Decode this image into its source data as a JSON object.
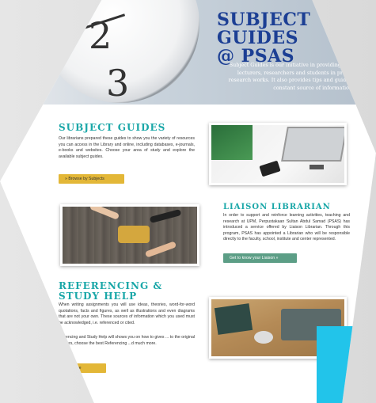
{
  "hero": {
    "title_line1": "SUBJECT",
    "title_line2": "GUIDES",
    "title_line3": "@ PSAS",
    "description": "Subject Guides is our initiative in providing be... lecturers, researchers and students in prep... research works. It also provides tips and guide... constant source of information.",
    "clock_numbers": [
      "2",
      "3"
    ]
  },
  "subject_guides": {
    "title": "SUBJECT GUIDES",
    "text": "Our librarians prepared these guides to show you the variety of resources you can access in the Library and online, including databases, e-journals, e-books and websites. Choose your area of study and explore the available subject guides.",
    "button": "» Browse by Subjects"
  },
  "liaison": {
    "title": "LIAISON LIBRARIAN",
    "text": "In order to support and reinforce learning activities, teaching and research at UPM, Perpustakaan Sultan Abdul Samad (PSAS) has introduced a service offered by Liaison Librarian. Through this program, PSAS has appointed a Librarian who will be responsible directly to the faculty, school, institute and center represented.",
    "button": "Get to know your Liaison »"
  },
  "referencing": {
    "title_line1": "REFERENCING &",
    "title_line2": "STUDY HELP",
    "text1": "When writing assignments you will use ideas, theories, word-for-word quotations, facts and figures, as well as illustrations and even diagrams that are not your own. These sources of information which you used must be acknowledged, i.e. referenced or cited.",
    "text2": "...erencing and Study Help will shows you on how to gives ... to the original authors, choose the best Referencing ...d much more.",
    "button": "...n More"
  },
  "colors": {
    "accent_teal": "#1aa7a8",
    "title_blue": "#1c3f94",
    "button_gold": "#e3b737",
    "button_green": "#5c9e86",
    "cyan_block": "#22c4ea"
  }
}
